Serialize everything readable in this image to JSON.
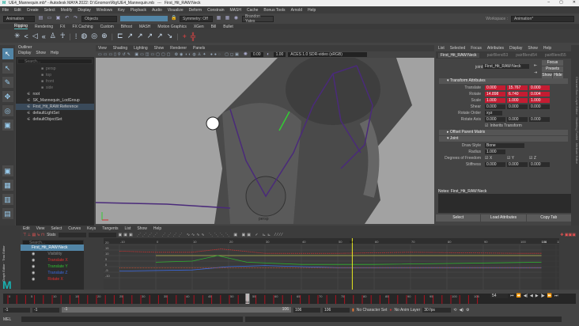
{
  "title": {
    "app": "UE4_Mannequin.mb* - Autodesk MAYA 2022: D:\\Gnomon\\Rig\\UE4_Mannequin.mb",
    "separator": "---",
    "node": "First_Hit_RAW:Neck"
  },
  "menu": [
    "File",
    "Edit",
    "Create",
    "Select",
    "Modify",
    "Display",
    "Windows",
    "Key",
    "Playback",
    "Audio",
    "Visualize",
    "Deform",
    "Constrain",
    "MASH",
    "Cache",
    "Bonus Tools",
    "Arnold",
    "Help"
  ],
  "toolbar": {
    "mode": "Animation",
    "objects": "Objects",
    "symmetry": "Symmetry: Off",
    "user": "Brandon Yates",
    "workspace_label": "Workspace :",
    "workspace": "Animation*"
  },
  "shelf_tabs": [
    "Rigging",
    "Rendering",
    "FX",
    "FX Caching",
    "Custom",
    "Bifrost",
    "MASH",
    "Motion Graphics",
    "XGen",
    "Bill",
    "Bullet"
  ],
  "shelf_active": "Rigging",
  "outliner": {
    "title": "Outliner",
    "menu": [
      "Display",
      "Show",
      "Help"
    ],
    "search": "Search...",
    "items": [
      {
        "label": "persp",
        "dim": true
      },
      {
        "label": "top",
        "dim": true
      },
      {
        "label": "front",
        "dim": true
      },
      {
        "label": "side",
        "dim": true
      },
      {
        "label": "root"
      },
      {
        "label": "SK_Mannequin_LodGroup"
      },
      {
        "label": "First_Hit_RAW:Reference",
        "selected": true
      },
      {
        "label": "defaultLightSet"
      },
      {
        "label": "defaultObjectSet"
      }
    ]
  },
  "viewport": {
    "menu": [
      "View",
      "Shading",
      "Lighting",
      "Show",
      "Renderer",
      "Panels"
    ],
    "exposure": "0.00",
    "gamma": "1.00",
    "colorspace": "ACES 1.0 SDR-video (sRGB)",
    "camera": "persp"
  },
  "attribute_editor": {
    "menu": [
      "List",
      "Selected",
      "Focus",
      "Attributes",
      "Display",
      "Show",
      "Help"
    ],
    "tabs": [
      "First_Hit_RAW:Neck",
      "pairBlend53",
      "pairBlend54",
      "pairBlend55",
      "pairB"
    ],
    "node_type": "joint:",
    "node_name": "First_Hit_RAW:Neck",
    "buttons": {
      "focus": "Focus",
      "presets": "Presets",
      "show": "Show",
      "hide": "Hide"
    },
    "transform_section": "Transform Attributes",
    "translate": {
      "label": "Translate",
      "values": [
        "0.000",
        "15.767",
        "0.000"
      ]
    },
    "rotate": {
      "label": "Rotate",
      "values": [
        "14.898",
        "6.740",
        "0.004"
      ]
    },
    "scale": {
      "label": "Scale",
      "values": [
        "1.000",
        "1.000",
        "1.000"
      ]
    },
    "shear": {
      "label": "Shear",
      "values": [
        "0.000",
        "0.000",
        "0.000"
      ]
    },
    "rotate_order": {
      "label": "Rotate Order",
      "value": "xyz"
    },
    "rotate_axis": {
      "label": "Rotate Axis",
      "values": [
        "0.000",
        "0.000",
        "0.000"
      ]
    },
    "inherits": "Inherits Transform",
    "offset_section": "Offset Parent Matrix",
    "joint_section": "Joint",
    "draw_style": {
      "label": "Draw Style",
      "value": "Bone"
    },
    "radius": {
      "label": "Radius",
      "value": "1.000"
    },
    "dof": {
      "label": "Degrees of Freedom",
      "axes": [
        "X",
        "Y",
        "Z"
      ]
    },
    "stiffness": {
      "label": "Stiffness",
      "values": [
        "0.000",
        "0.000",
        "0.000"
      ]
    },
    "notes": "Notes: First_Hit_RAW:Neck",
    "bottom_buttons": [
      "Select",
      "Load Attributes",
      "Copy Tab"
    ],
    "side_tabs": [
      "Channel Box / Layer Editor",
      "Modeling Toolkit",
      "Attribute Editor"
    ]
  },
  "graph_editor": {
    "side_tabs": [
      "Graph Editor",
      "Trax Editor"
    ],
    "menu": [
      "Edit",
      "View",
      "Select",
      "Curves",
      "Keys",
      "Tangents",
      "List",
      "Show",
      "Help"
    ],
    "stats": "Stats",
    "search": "Search...",
    "node": "First_Hit_RAW:Neck",
    "channels": [
      {
        "label": "Visibility",
        "color": "#8a8a8a"
      },
      {
        "label": "Translate X",
        "color": "#e03030"
      },
      {
        "label": "Translate Y",
        "color": "#30c030"
      },
      {
        "label": "Translate Z",
        "color": "#3a6ae0"
      },
      {
        "label": "Rotate X",
        "color": "#e03030"
      }
    ],
    "y_ticks": [
      "20",
      "15",
      "10",
      "5",
      "0",
      "-5",
      "-10"
    ],
    "x_ticks": [
      "-10",
      "0",
      "10",
      "20",
      "30",
      "40",
      "50",
      "60",
      "70",
      "80",
      "90",
      "100",
      "110"
    ],
    "current_frame": "54",
    "end_marker": "106"
  },
  "timeline": {
    "ticks": [
      "0",
      "5",
      "10",
      "15",
      "20",
      "25",
      "30",
      "35",
      "40",
      "45",
      "50",
      "55",
      "60",
      "65",
      "70",
      "75",
      "80",
      "85",
      "90",
      "95",
      "100",
      "105"
    ],
    "current": "54",
    "frame_field": "54"
  },
  "range": {
    "start": "-1",
    "start2": "-1",
    "slider_start": "-1",
    "slider_end": "106",
    "end": "106",
    "end2": "106",
    "character_set": "No Character Set",
    "anim_layer": "No Anim Layer",
    "fps": "30 fps"
  },
  "command": {
    "lang": "MEL"
  }
}
